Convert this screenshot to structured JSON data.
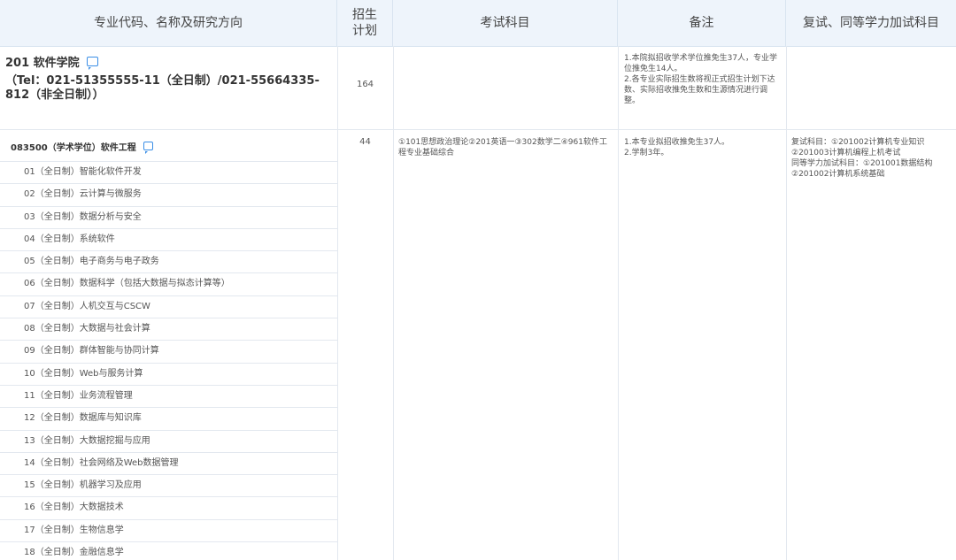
{
  "header": {
    "col1": "专业代码、名称及研究方向",
    "col2_line1": "招生",
    "col2_line2": "计划",
    "col3": "考试科目",
    "col4": "备注",
    "col5": "复试、同等学力加试科目"
  },
  "school": {
    "name": "201 软件学院",
    "tel": "（Tel：021-51355555-11（全日制）/021-55664335-812（非全日制））",
    "plan": "164",
    "notes_1": "1.本院拟招收学术学位推免生37人，专业学位推免生14人。",
    "notes_2": "2.各专业实际招生数将视正式招生计划下达数、实际招收推免生数和生源情况进行调整。"
  },
  "major": {
    "title": "083500（学术学位）软件工程",
    "plan": "44",
    "exam": "①101思想政治理论②201英语一③302数学二④961软件工程专业基础综合",
    "notes_1": "1.本专业拟招收推免生37人。",
    "notes_2": "2.学制3年。",
    "retest_1": "复试科目：①201002计算机专业知识",
    "retest_2": "②201003计算机编程上机考试",
    "retest_3": "同等学力加试科目：①201001数据结构",
    "retest_4": "②201002计算机系统基础"
  },
  "directions": [
    "01（全日制）智能化软件开发",
    "02（全日制）云计算与微服务",
    "03（全日制）数据分析与安全",
    "04（全日制）系统软件",
    "05（全日制）电子商务与电子政务",
    "06（全日制）数据科学（包括大数据与拟态计算等）",
    "07（全日制）人机交互与CSCW",
    "08（全日制）大数据与社会计算",
    "09（全日制）群体智能与协同计算",
    "10（全日制）Web与服务计算",
    "11（全日制）业务流程管理",
    "12（全日制）数据库与知识库",
    "13（全日制）大数据挖掘与应用",
    "14（全日制）社会网络及Web数据管理",
    "15（全日制）机器学习及应用",
    "16（全日制）大数据技术",
    "17（全日制）生物信息学",
    "18（全日制）金融信息学"
  ],
  "colors": {
    "header_bg": "#eef4fb",
    "icon_blue": "#3a8ee6",
    "grid": "#e3e8ef"
  },
  "icons": {
    "school_comment": "message-icon",
    "major_comment": "message-icon"
  }
}
